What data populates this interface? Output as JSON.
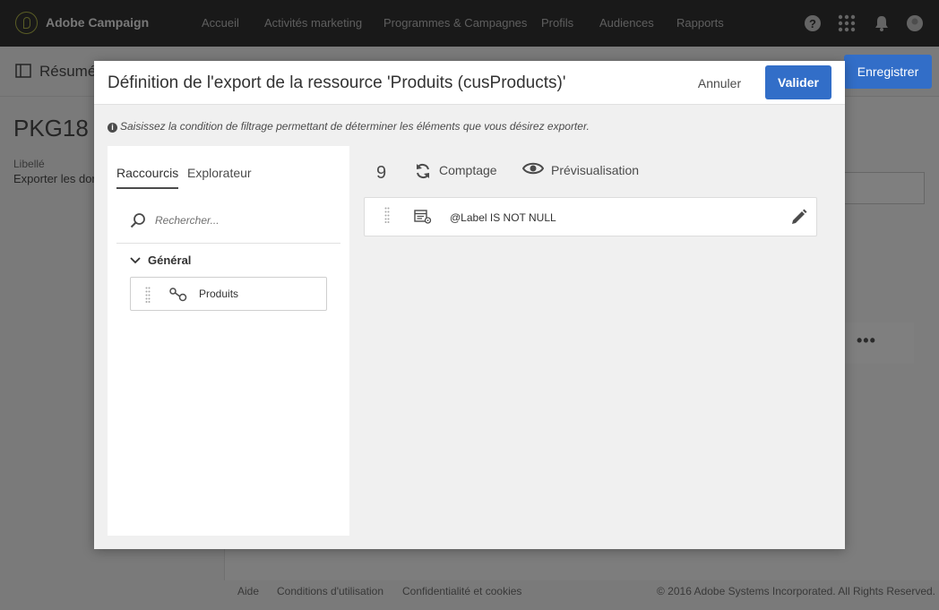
{
  "app": {
    "brand": "Adobe Campaign"
  },
  "nav": {
    "items": [
      {
        "label": "Accueil"
      },
      {
        "label": "Activités marketing"
      },
      {
        "label": "Programmes & Campagnes"
      },
      {
        "label": "Profils"
      },
      {
        "label": "Audiences"
      },
      {
        "label": "Rapports"
      }
    ]
  },
  "background": {
    "subbar_title": "Résumé",
    "save_label": "Enregistrer",
    "package_title": "PKG18",
    "label_caption": "Libellé",
    "label_value": "Exporter les dor",
    "more": "•••",
    "footer": {
      "help": "Aide",
      "terms": "Conditions d'utilisation",
      "privacy": "Confidentialité et cookies",
      "copyright": "© 2016 Adobe Systems Incorporated. All Rights Reserved."
    }
  },
  "modal": {
    "title": "Définition de l'export de la ressource 'Produits (cusProducts)'",
    "cancel_label": "Annuler",
    "validate_label": "Valider",
    "info": "Saisissez la condition de filtrage permettant de déterminer les éléments que vous désirez exporter.",
    "tabs": [
      {
        "label": "Raccourcis"
      },
      {
        "label": "Explorateur"
      }
    ],
    "search_placeholder": "Rechercher...",
    "group_label": "Général",
    "palette_item_label": "Produits",
    "count": "9",
    "count_label": "Comptage",
    "preview_label": "Prévisualisation",
    "rule_text": "@Label IS NOT NULL"
  },
  "colors": {
    "accent": "#326ec8",
    "topbar": "#323232",
    "overlay": "rgba(0,0,0,0.5)"
  }
}
